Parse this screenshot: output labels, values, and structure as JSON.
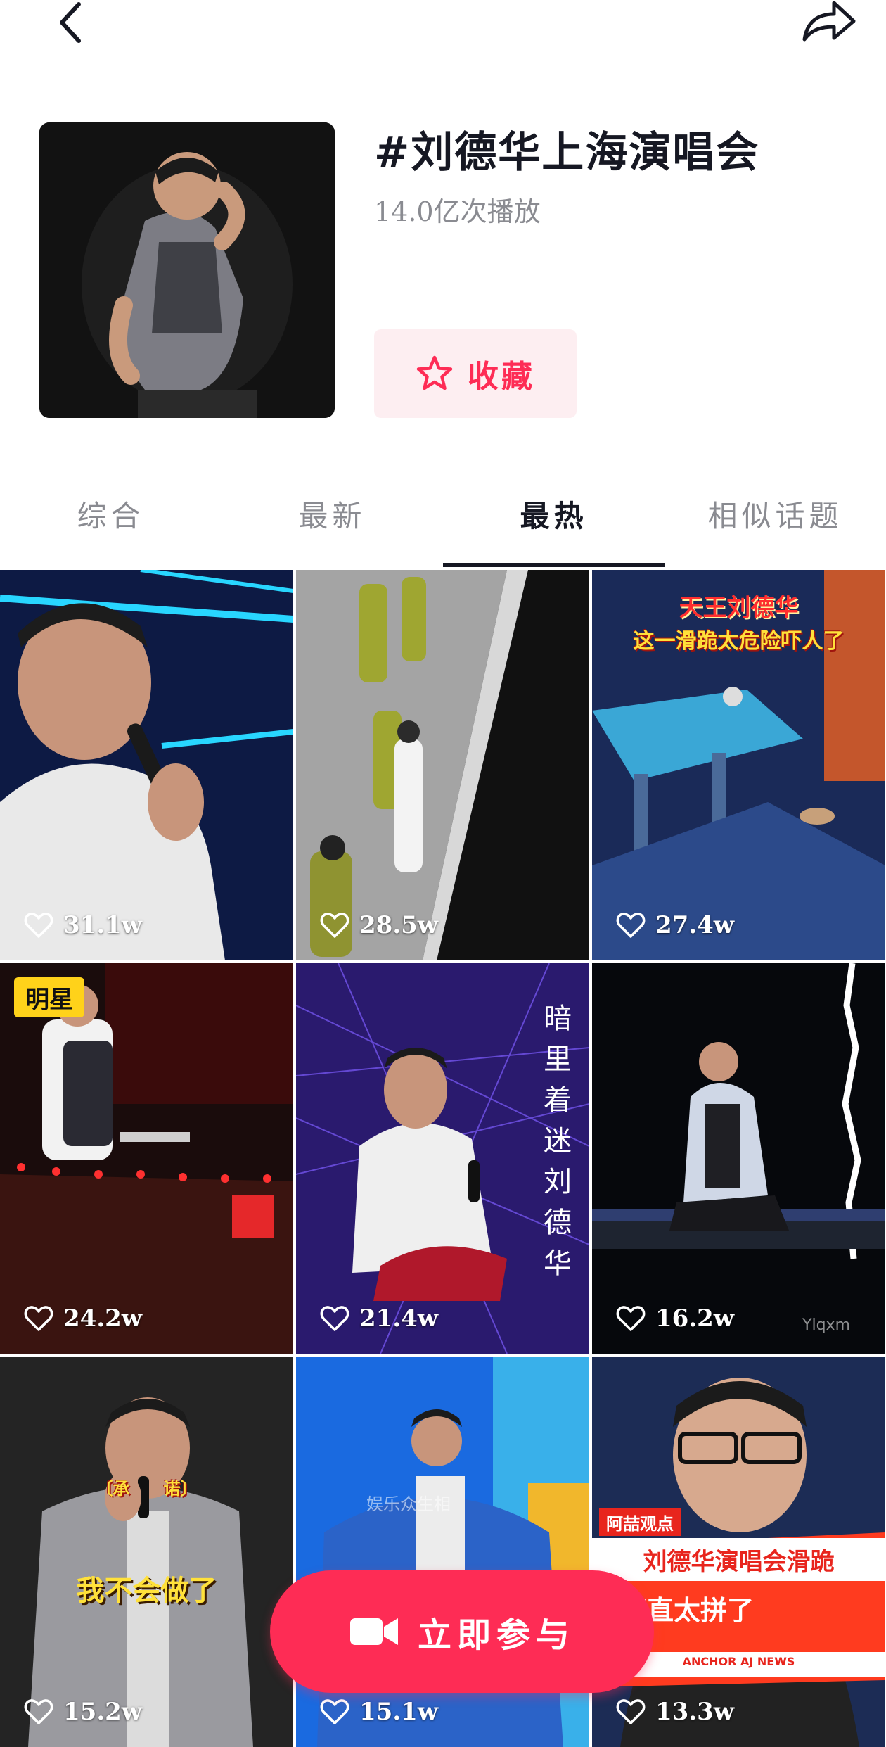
{
  "topbar": {
    "back_icon": "chevron-left-icon",
    "share_icon": "share-arrow-icon"
  },
  "topic": {
    "title": "#刘德华上海演唱会",
    "plays": "14.0亿次播放",
    "favorite_label": "收藏",
    "favorite_icon": "star-outline-icon"
  },
  "tabs": [
    {
      "label": "综合",
      "active": false
    },
    {
      "label": "最新",
      "active": false
    },
    {
      "label": "最热",
      "active": true
    },
    {
      "label": "相似话题",
      "active": false
    }
  ],
  "videos": [
    {
      "likes": "31.1w"
    },
    {
      "likes": "28.5w"
    },
    {
      "likes": "27.4w",
      "caption_line1": "天王刘德华",
      "caption_line2": "这一滑跪太危险吓人了"
    },
    {
      "likes": "24.2w",
      "badge": "明星"
    },
    {
      "likes": "21.4w",
      "vertical_text": "暗里着迷 刘德华"
    },
    {
      "likes": "16.2w",
      "watermark": "Ylqxm"
    },
    {
      "likes": "15.2w",
      "caption_small": "〔承　　诺〕",
      "caption_main": "我不会做了"
    },
    {
      "likes": "15.1w",
      "watermark": "娱乐众生相"
    },
    {
      "likes": "13.3w",
      "banner_tag": "阿喆观点",
      "banner_line1": "刘德华演唱会滑跪",
      "banner_line2": "简直太拼了",
      "banner_footer": "ANCHOR AJ NEWS"
    }
  ],
  "join_button": {
    "label": "立即参与",
    "icon": "video-camera-icon"
  },
  "colors": {
    "accent": "#fe2c55",
    "accent_bg": "#fdeef1",
    "text": "#161823",
    "muted": "#8a8b91"
  }
}
